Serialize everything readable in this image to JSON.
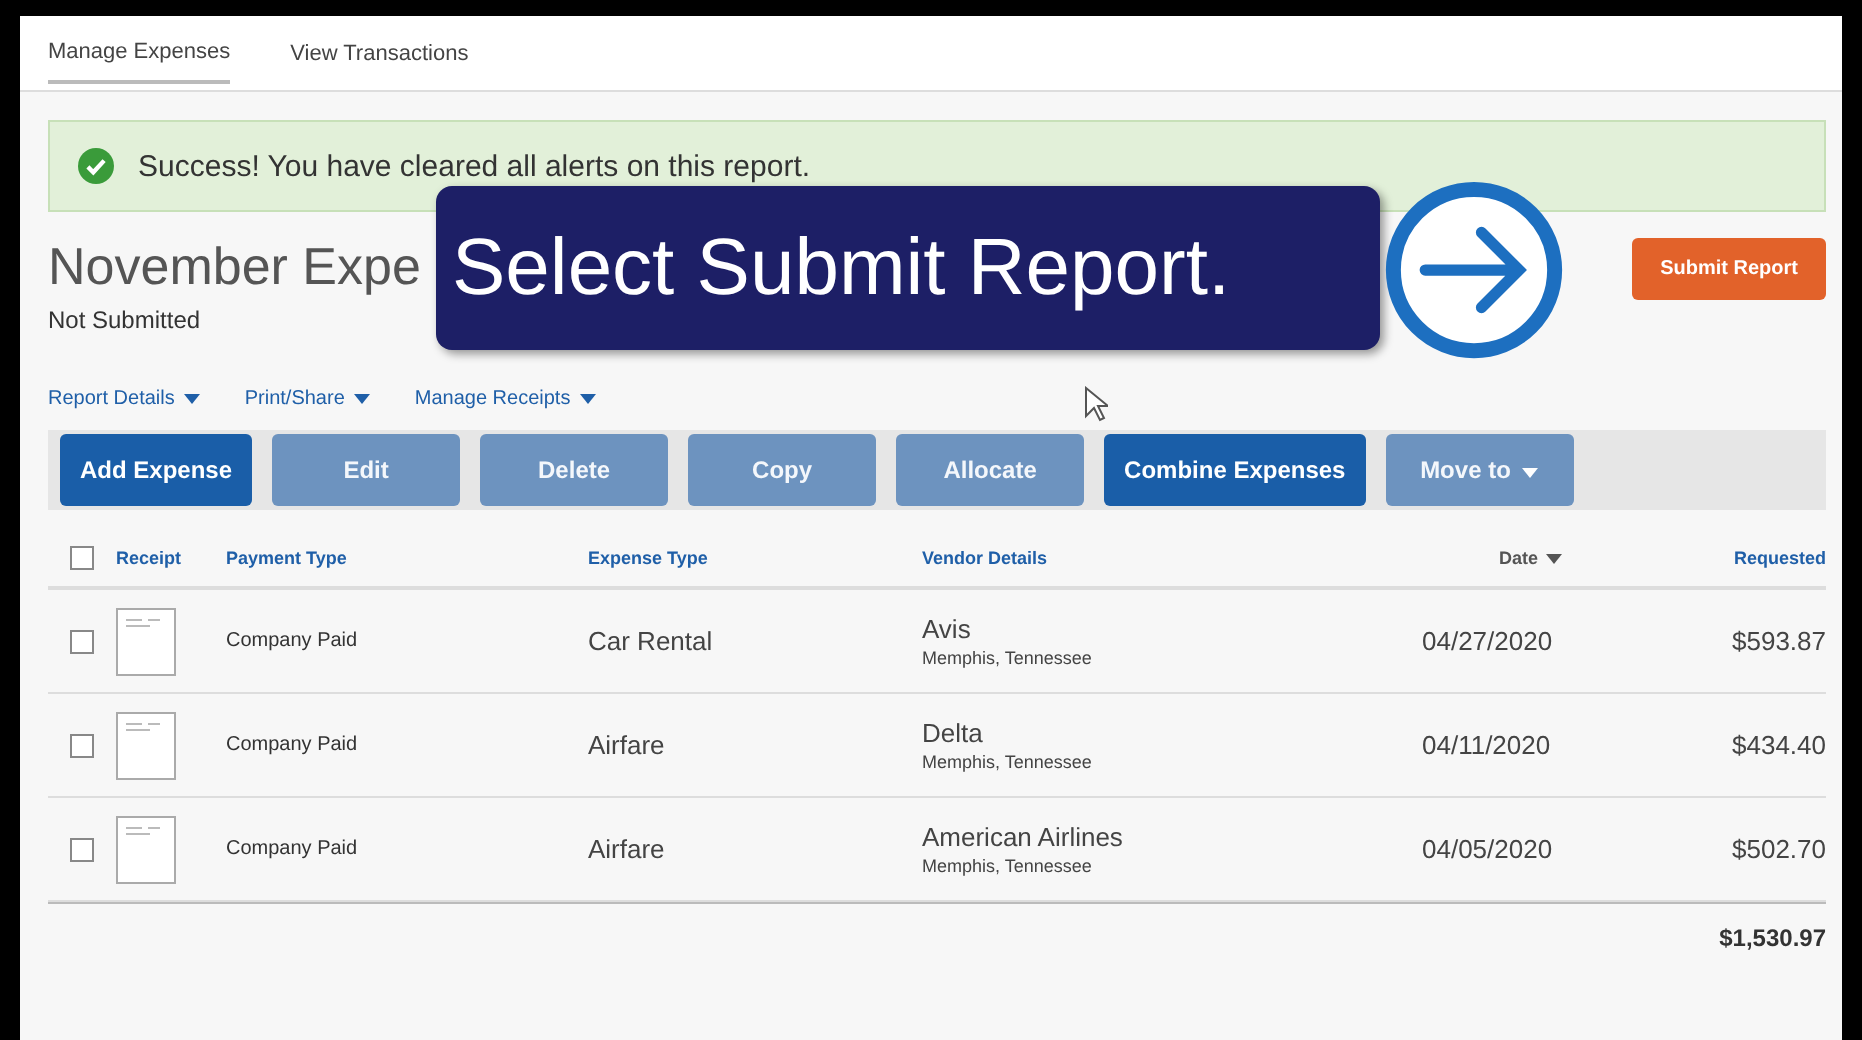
{
  "tabs": [
    {
      "label": "Manage Expenses",
      "selected": true
    },
    {
      "label": "View Transactions",
      "selected": false
    }
  ],
  "alert": {
    "kind": "success",
    "message": "Success! You have cleared all alerts on this report."
  },
  "report": {
    "title": "November Expe",
    "status": "Not Submitted"
  },
  "callout": {
    "text": "Select Submit Report."
  },
  "submit_button": "Submit Report",
  "menus": [
    "Report Details",
    "Print/Share",
    "Manage Receipts"
  ],
  "toolbar": [
    {
      "label": "Add Expense",
      "disabled": false,
      "dropdown": false
    },
    {
      "label": "Edit",
      "disabled": true,
      "dropdown": false
    },
    {
      "label": "Delete",
      "disabled": true,
      "dropdown": false
    },
    {
      "label": "Copy",
      "disabled": true,
      "dropdown": false
    },
    {
      "label": "Allocate",
      "disabled": true,
      "dropdown": false
    },
    {
      "label": "Combine Expenses",
      "disabled": false,
      "dropdown": false
    },
    {
      "label": "Move to",
      "disabled": true,
      "dropdown": true
    }
  ],
  "table": {
    "select_all_checked": false,
    "columns": [
      "Receipt",
      "Payment Type",
      "Expense Type",
      "Vendor Details",
      "Date",
      "Requested"
    ],
    "rows": [
      {
        "checked": false,
        "payment_type": "Company Paid",
        "expense_type": "Car Rental",
        "vendor": "Avis",
        "location": "Memphis, Tennessee",
        "date": "04/27/2020",
        "requested": "$593.87"
      },
      {
        "checked": false,
        "payment_type": "Company Paid",
        "expense_type": "Airfare",
        "vendor": "Delta",
        "location": "Memphis, Tennessee",
        "date": "04/11/2020",
        "requested": "$434.40"
      },
      {
        "checked": false,
        "payment_type": "Company Paid",
        "expense_type": "Airfare",
        "vendor": "American Airlines",
        "location": "Memphis, Tennessee",
        "date": "04/05/2020",
        "requested": "$502.70"
      }
    ],
    "total": "$1,530.97"
  }
}
